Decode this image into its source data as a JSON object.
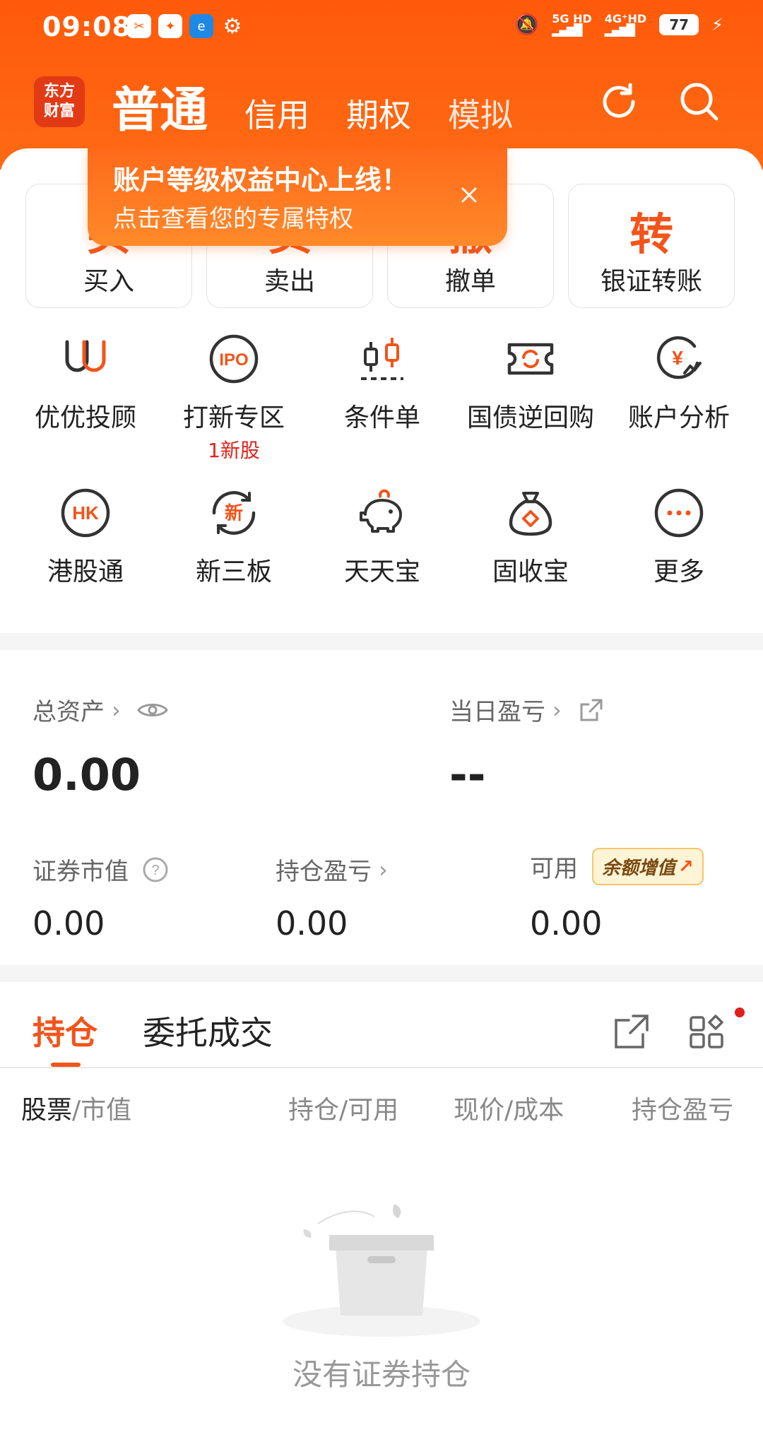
{
  "status_bar": {
    "time": "09:08",
    "network1": "5G HD",
    "network2": "4G⁺HD",
    "battery": "77"
  },
  "header": {
    "logo_line1": "东方",
    "logo_line2": "财富",
    "tabs": [
      {
        "label": "普通"
      },
      {
        "label": "信用"
      },
      {
        "label": "期权"
      },
      {
        "label": "模拟"
      }
    ]
  },
  "tooltip": {
    "title": "账户等级权益中心上线！",
    "subtitle": "点击查看您的专属特权"
  },
  "actions": [
    {
      "label": "买入",
      "icon": "买"
    },
    {
      "label": "卖出",
      "icon": "卖"
    },
    {
      "label": "撤单",
      "icon": "撤"
    },
    {
      "label": "银证转账",
      "icon": "转"
    }
  ],
  "grid": [
    {
      "label": "优优投顾",
      "icon": "uu-advisor-icon"
    },
    {
      "label": "打新专区",
      "icon": "ipo-icon",
      "sub": "1新股"
    },
    {
      "label": "条件单",
      "icon": "candlestick-icon"
    },
    {
      "label": "国债逆回购",
      "icon": "repo-icon"
    },
    {
      "label": "账户分析",
      "icon": "yen-chart-icon"
    },
    {
      "label": "港股通",
      "icon": "hk-icon",
      "icon_text": "HK"
    },
    {
      "label": "新三板",
      "icon": "new-board-icon",
      "icon_text": "新"
    },
    {
      "label": "天天宝",
      "icon": "piggy-bank-icon"
    },
    {
      "label": "固收宝",
      "icon": "money-bag-icon"
    },
    {
      "label": "更多",
      "icon": "more-icon"
    }
  ],
  "assets": {
    "total_label": "总资产",
    "total_value": "0.00",
    "daily_label": "当日盈亏",
    "daily_value": "--",
    "market_label": "证券市值",
    "market_value": "0.00",
    "holding_pl_label": "持仓盈亏",
    "holding_pl_value": "0.00",
    "available_label": "可用",
    "available_value": "0.00",
    "badge_label": "余额增值"
  },
  "positions": {
    "tab_active": "持仓",
    "tab_other": "委托成交",
    "col1_a": "股票",
    "col1_b": "/市值",
    "col2": "持仓/可用",
    "col3": "现价/成本",
    "col4": "持仓盈亏",
    "empty_text": "没有证券持仓"
  }
}
